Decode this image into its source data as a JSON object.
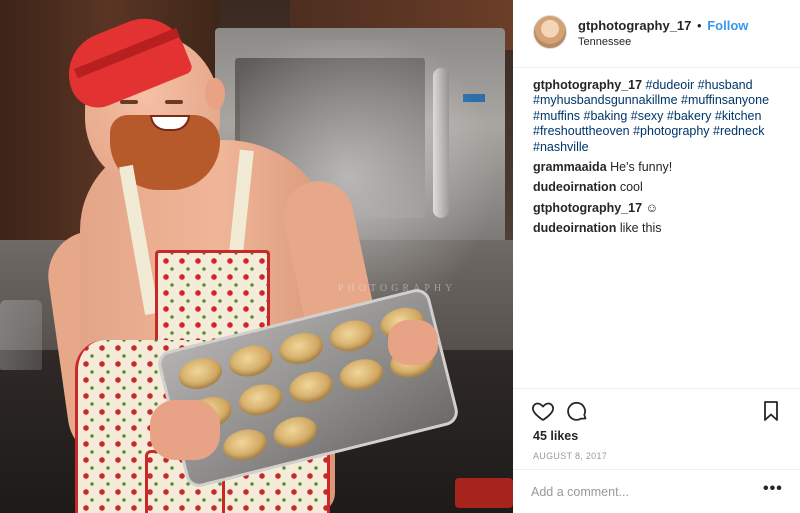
{
  "post": {
    "watermark": "PHOTOGRAPHY"
  },
  "header": {
    "username": "gtphotography_17",
    "separator": "•",
    "follow_label": "Follow",
    "location": "Tennessee"
  },
  "caption": {
    "username": "gtphotography_17",
    "hashtags": [
      "#dudeoir",
      "#husband",
      "#myhusbandsgunnakillme",
      "#muffinsanyone",
      "#muffins",
      "#baking",
      "#sexy",
      "#bakery",
      "#kitchen",
      "#freshouttheoven",
      "#photography",
      "#redneck",
      "#nashville"
    ]
  },
  "comments": [
    {
      "user": "grammaaida",
      "text": "He's funny!"
    },
    {
      "user": "dudeoirnation",
      "text": "cool"
    },
    {
      "user": "gtphotography_17",
      "text": "☺"
    },
    {
      "user": "dudeoirnation",
      "text": "like this"
    }
  ],
  "actions": {
    "icons": [
      "heart-icon",
      "comment-icon",
      "bookmark-icon"
    ],
    "likes": "45 likes",
    "date": "AUGUST 8, 2017"
  },
  "comment_box": {
    "placeholder": "Add a comment...",
    "more_label": "•••"
  },
  "colors": {
    "follow": "#3897f0",
    "hashtag": "#003569",
    "muted": "#999999"
  }
}
